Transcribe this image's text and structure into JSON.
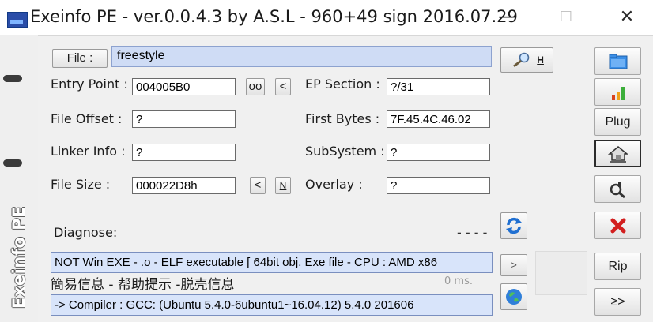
{
  "window": {
    "title": "Exeinfo PE - ver.0.0.4.3  by A.S.L -  960+49 sign  2016.07.29",
    "minimize_icon": "minimize-icon",
    "maximize_icon": "maximize-icon",
    "close_icon": "close-icon",
    "minimize_glyph": "—",
    "maximize_glyph": "☐",
    "close_glyph": "✕"
  },
  "sidebar": {
    "logo_text": "Exeinfo PE"
  },
  "file": {
    "button_label": "File :",
    "value": "freestyle"
  },
  "fields": {
    "entry_point_label": "Entry Point :",
    "entry_point_value": "004005B0",
    "oo_button": "oo",
    "lt_button": "<",
    "ep_section_label": "EP Section :",
    "ep_section_value": "?/31",
    "file_offset_label": "File Offset :",
    "file_offset_value": "?",
    "first_bytes_label": "First Bytes :",
    "first_bytes_value": "7F.45.4C.46.02",
    "linker_info_label": "Linker Info :",
    "linker_info_value": "?",
    "subsystem_label": "SubSystem :",
    "subsystem_value": "?",
    "file_size_label": "File Size :",
    "file_size_value": "000022D8h",
    "lt2_button": "<",
    "n_button": "N",
    "overlay_label": "Overlay :",
    "overlay_value": "?"
  },
  "diagnose": {
    "label": "Diagnose:",
    "dashes": "- - - -",
    "result_line": "NOT Win EXE - .o - ELF executable [ 64bit obj. Exe file - CPU : AMD x86",
    "chinese_line": "簡易信息 - 帮助提示 -脱壳信息",
    "time": "0 ms.",
    "compiler_line": " -> Compiler : GCC: (Ubuntu 5.4.0-6ubuntu1~16.04.12) 5.4.0 201606",
    "gt_button": ">"
  },
  "right_buttons": {
    "search_h_label": "H",
    "plug_label": "Plug",
    "rip_label": "Rip",
    "more_label": "≥>"
  },
  "colors": {
    "info_box_bg": "#d8e4fa",
    "file_box_bg": "#cfdcf5",
    "accent_blue": "#2a4da8",
    "close_red": "#d21f1f"
  }
}
